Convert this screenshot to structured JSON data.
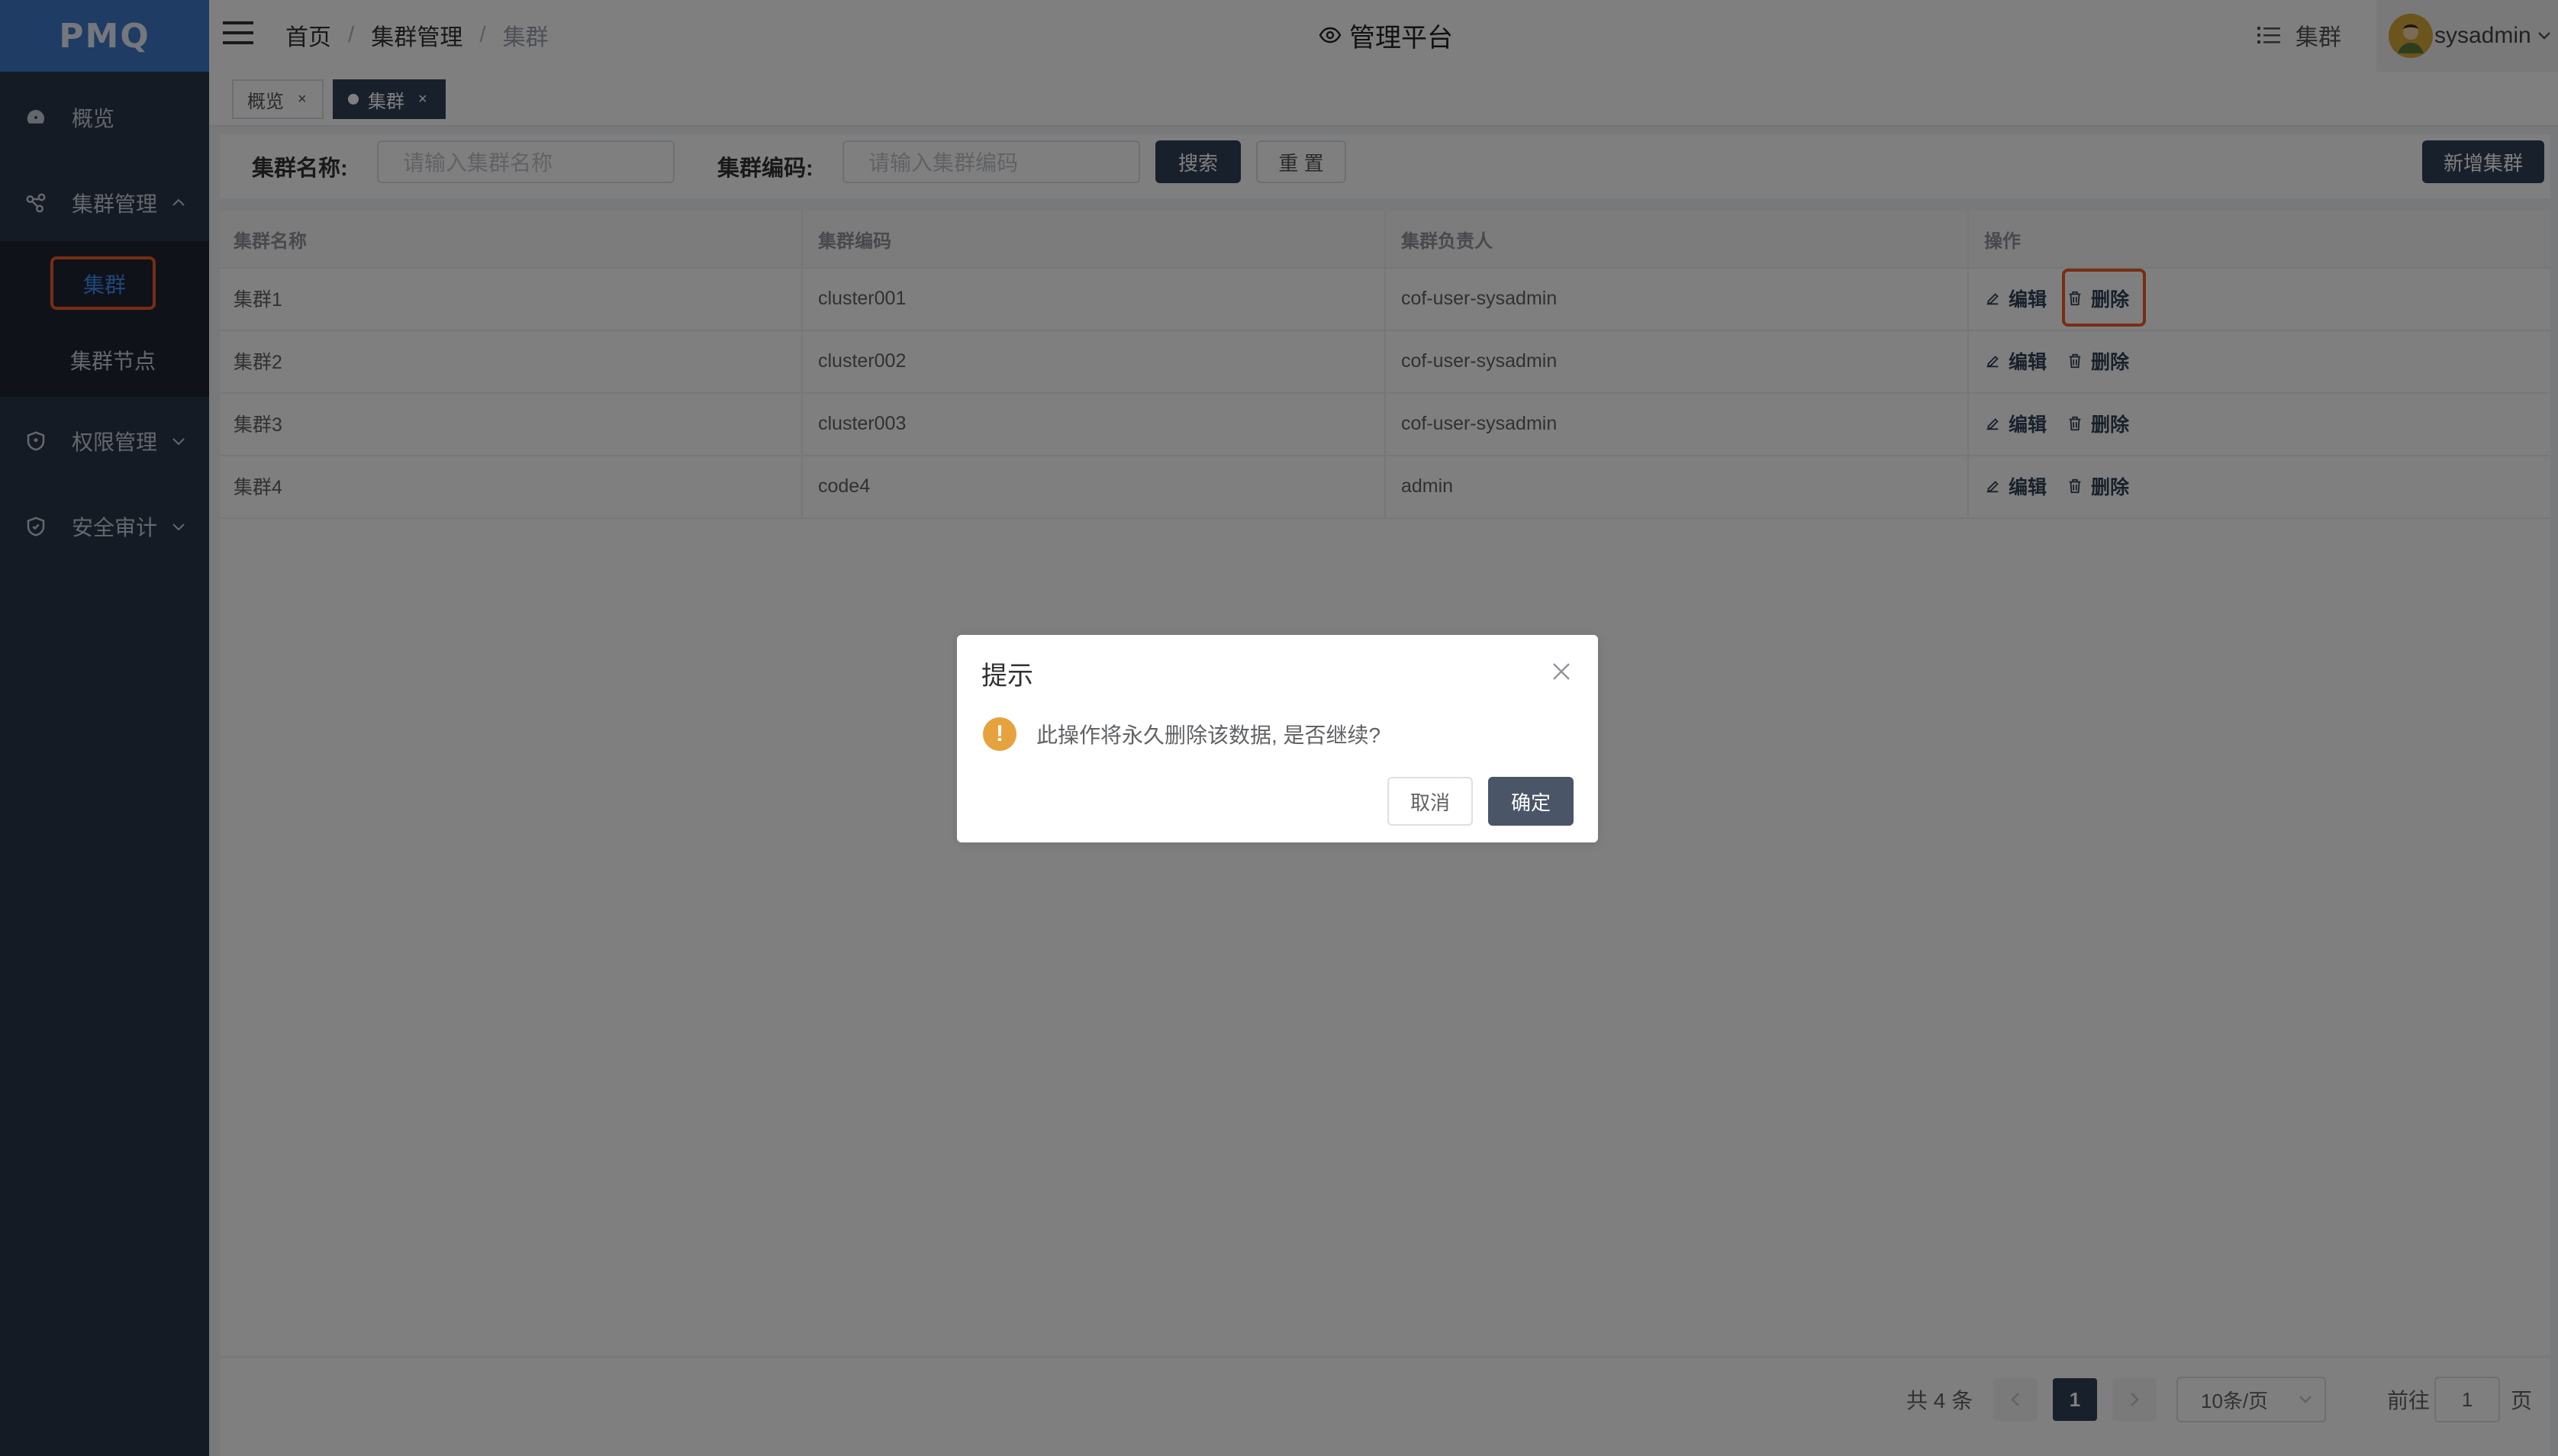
{
  "app": {
    "logo_text": "PMQ",
    "platform_title": "管理平台"
  },
  "breadcrumb": [
    "首页",
    "集群管理",
    "集群"
  ],
  "header": {
    "cluster_link": "集群",
    "username": "sysadmin"
  },
  "sidebar": {
    "items": [
      {
        "label": "概览",
        "icon": "dashboard-icon"
      },
      {
        "label": "集群管理",
        "icon": "cluster-icon"
      },
      {
        "label": "权限管理",
        "icon": "shield-icon"
      },
      {
        "label": "安全审计",
        "icon": "shield-icon"
      }
    ],
    "submenu": [
      "集群",
      "集群节点"
    ]
  },
  "tabs": [
    {
      "label": "概览",
      "close": "×"
    },
    {
      "label": "集群",
      "close": "×"
    }
  ],
  "search": {
    "name_label": "集群名称:",
    "name_placeholder": "请输入集群名称",
    "code_label": "集群编码:",
    "code_placeholder": "请输入集群编码",
    "search_btn": "搜索",
    "reset_btn": "重 置",
    "add_btn": "新增集群"
  },
  "table": {
    "headers": [
      "集群名称",
      "集群编码",
      "集群负责人",
      "操作"
    ],
    "rows": [
      {
        "name": "集群1",
        "code": "cluster001",
        "owner": "cof-user-sysadmin"
      },
      {
        "name": "集群2",
        "code": "cluster002",
        "owner": "cof-user-sysadmin"
      },
      {
        "name": "集群3",
        "code": "cluster003",
        "owner": "cof-user-sysadmin"
      },
      {
        "name": "集群4",
        "code": "code4",
        "owner": "admin"
      }
    ],
    "edit_label": "编辑",
    "delete_label": "删除"
  },
  "pagination": {
    "total": "共 4 条",
    "current": "1",
    "page_size": "10条/页",
    "goto_label": "前往",
    "goto_value": "1",
    "page_suffix": "页"
  },
  "dialog": {
    "title": "提示",
    "message": "此操作将永久删除该数据, 是否继续?",
    "cancel": "取消",
    "confirm": "确定",
    "warn_glyph": "!"
  },
  "colors": {
    "sidebar": "#2b3648",
    "logo_bg": "#3d78c9",
    "primary": "#304156",
    "highlight": "#f05a28",
    "warning": "#e6a23c"
  }
}
